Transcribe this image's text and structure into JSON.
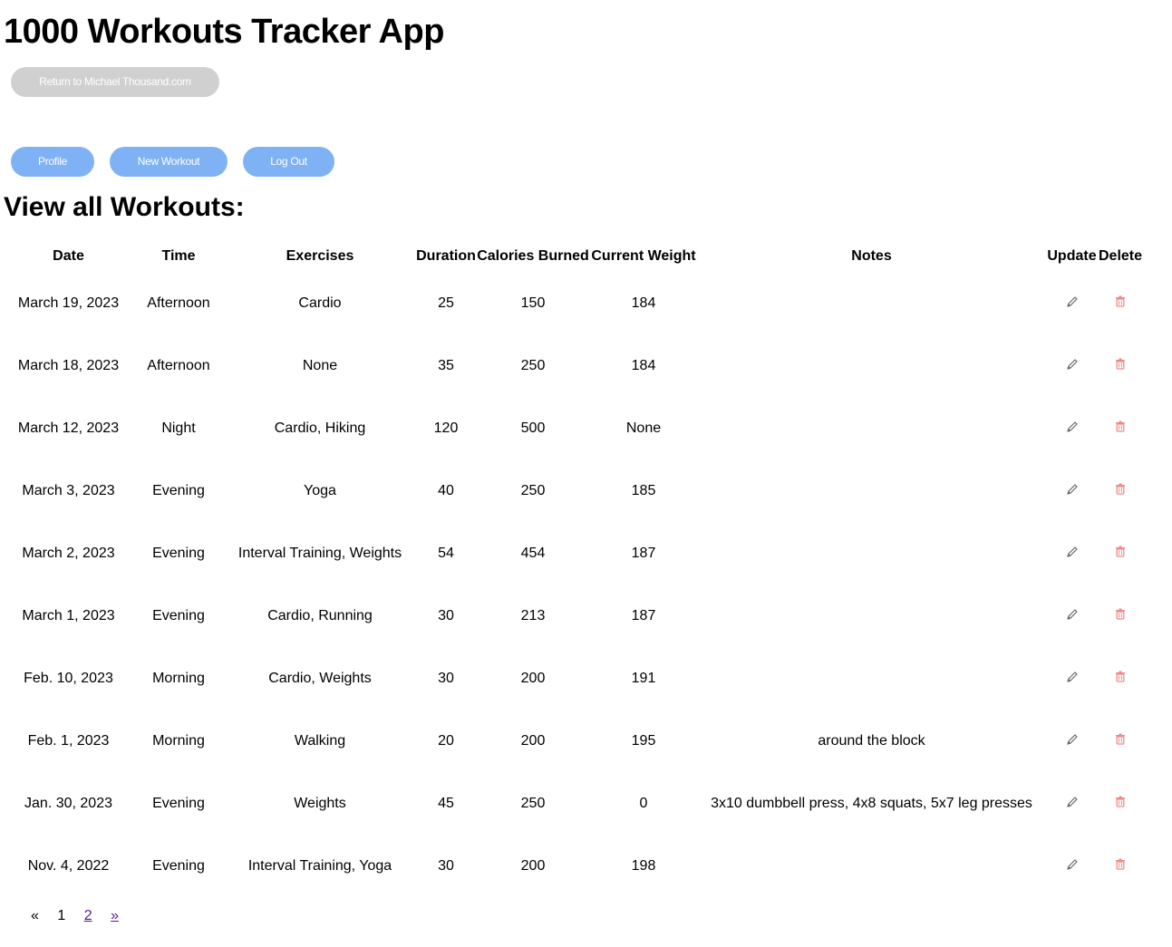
{
  "app": {
    "title": "1000 Workouts Tracker App",
    "return_label": "Return to Michael Thousand.com"
  },
  "nav": {
    "profile_label": "Profile",
    "new_workout_label": "New Workout",
    "logout_label": "Log Out"
  },
  "section_title": "View all Workouts:",
  "table": {
    "headers": {
      "date": "Date",
      "time": "Time",
      "exercises": "Exercises",
      "duration": "Duration",
      "calories": "Calories Burned",
      "weight": "Current Weight",
      "notes": "Notes",
      "update": "Update",
      "delete": "Delete"
    },
    "rows": [
      {
        "date": "March 19, 2023",
        "time": "Afternoon",
        "exercises": "Cardio",
        "duration": "25",
        "calories": "150",
        "weight": "184",
        "notes": ""
      },
      {
        "date": "March 18, 2023",
        "time": "Afternoon",
        "exercises": "None",
        "duration": "35",
        "calories": "250",
        "weight": "184",
        "notes": ""
      },
      {
        "date": "March 12, 2023",
        "time": "Night",
        "exercises": "Cardio, Hiking",
        "duration": "120",
        "calories": "500",
        "weight": "None",
        "notes": ""
      },
      {
        "date": "March 3, 2023",
        "time": "Evening",
        "exercises": "Yoga",
        "duration": "40",
        "calories": "250",
        "weight": "185",
        "notes": ""
      },
      {
        "date": "March 2, 2023",
        "time": "Evening",
        "exercises": "Interval Training, Weights",
        "duration": "54",
        "calories": "454",
        "weight": "187",
        "notes": ""
      },
      {
        "date": "March 1, 2023",
        "time": "Evening",
        "exercises": "Cardio, Running",
        "duration": "30",
        "calories": "213",
        "weight": "187",
        "notes": ""
      },
      {
        "date": "Feb. 10, 2023",
        "time": "Morning",
        "exercises": "Cardio, Weights",
        "duration": "30",
        "calories": "200",
        "weight": "191",
        "notes": ""
      },
      {
        "date": "Feb. 1, 2023",
        "time": "Morning",
        "exercises": "Walking",
        "duration": "20",
        "calories": "200",
        "weight": "195",
        "notes": "around the block"
      },
      {
        "date": "Jan. 30, 2023",
        "time": "Evening",
        "exercises": "Weights",
        "duration": "45",
        "calories": "250",
        "weight": "0",
        "notes": "3x10 dumbbell press, 4x8 squats, 5x7 leg presses"
      },
      {
        "date": "Nov. 4, 2022",
        "time": "Evening",
        "exercises": "Interval Training, Yoga",
        "duration": "30",
        "calories": "200",
        "weight": "198",
        "notes": ""
      }
    ],
    "update_icon": "pencil-icon",
    "delete_icon": "trash-icon"
  },
  "pagination": {
    "prev": "«",
    "current": "1",
    "next_page": "2",
    "next": "»"
  },
  "colors": {
    "primary_button": "#7fb2f5",
    "secondary_button": "#d0d0d0",
    "delete_icon": "#f08a8a",
    "update_icon": "#666666",
    "link": "#551a8b"
  }
}
